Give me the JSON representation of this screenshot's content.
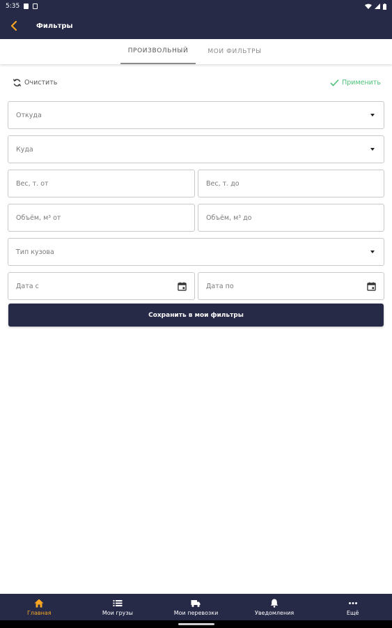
{
  "status_bar": {
    "time": "5:35"
  },
  "app_bar": {
    "title": "Фильтры"
  },
  "tabs": [
    {
      "label": "ПРОИЗВОЛЬНЫЙ",
      "active": true
    },
    {
      "label": "МОИ ФИЛЬТРЫ",
      "active": false
    }
  ],
  "actions": {
    "clear_label": "Очистить",
    "apply_label": "Применить"
  },
  "form": {
    "from_placeholder": "Откуда",
    "to_placeholder": "Куда",
    "weight_from_placeholder": "Вес, т. от",
    "weight_to_placeholder": "Вес, т. до",
    "volume_from_placeholder": "Объём, м³ от",
    "volume_to_placeholder": "Объём, м³ до",
    "body_type_placeholder": "Тип кузова",
    "date_from_placeholder": "Дата с",
    "date_to_placeholder": "Дата по"
  },
  "save_button": {
    "label": "Сохранить в мои фильтры"
  },
  "bottom_nav": [
    {
      "label": "Главная",
      "icon": "home-icon",
      "active": true
    },
    {
      "label": "Мои грузы",
      "icon": "list-icon",
      "active": false
    },
    {
      "label": "Мои перевозки",
      "icon": "truck-icon",
      "active": false
    },
    {
      "label": "Уведомления",
      "icon": "bell-icon",
      "active": false
    },
    {
      "label": "Ещё",
      "icon": "more-icon",
      "active": false
    }
  ],
  "colors": {
    "primary": "#262a46",
    "accent": "#f5a623",
    "apply_green": "#4dc07a",
    "border": "#c9c9c9"
  }
}
